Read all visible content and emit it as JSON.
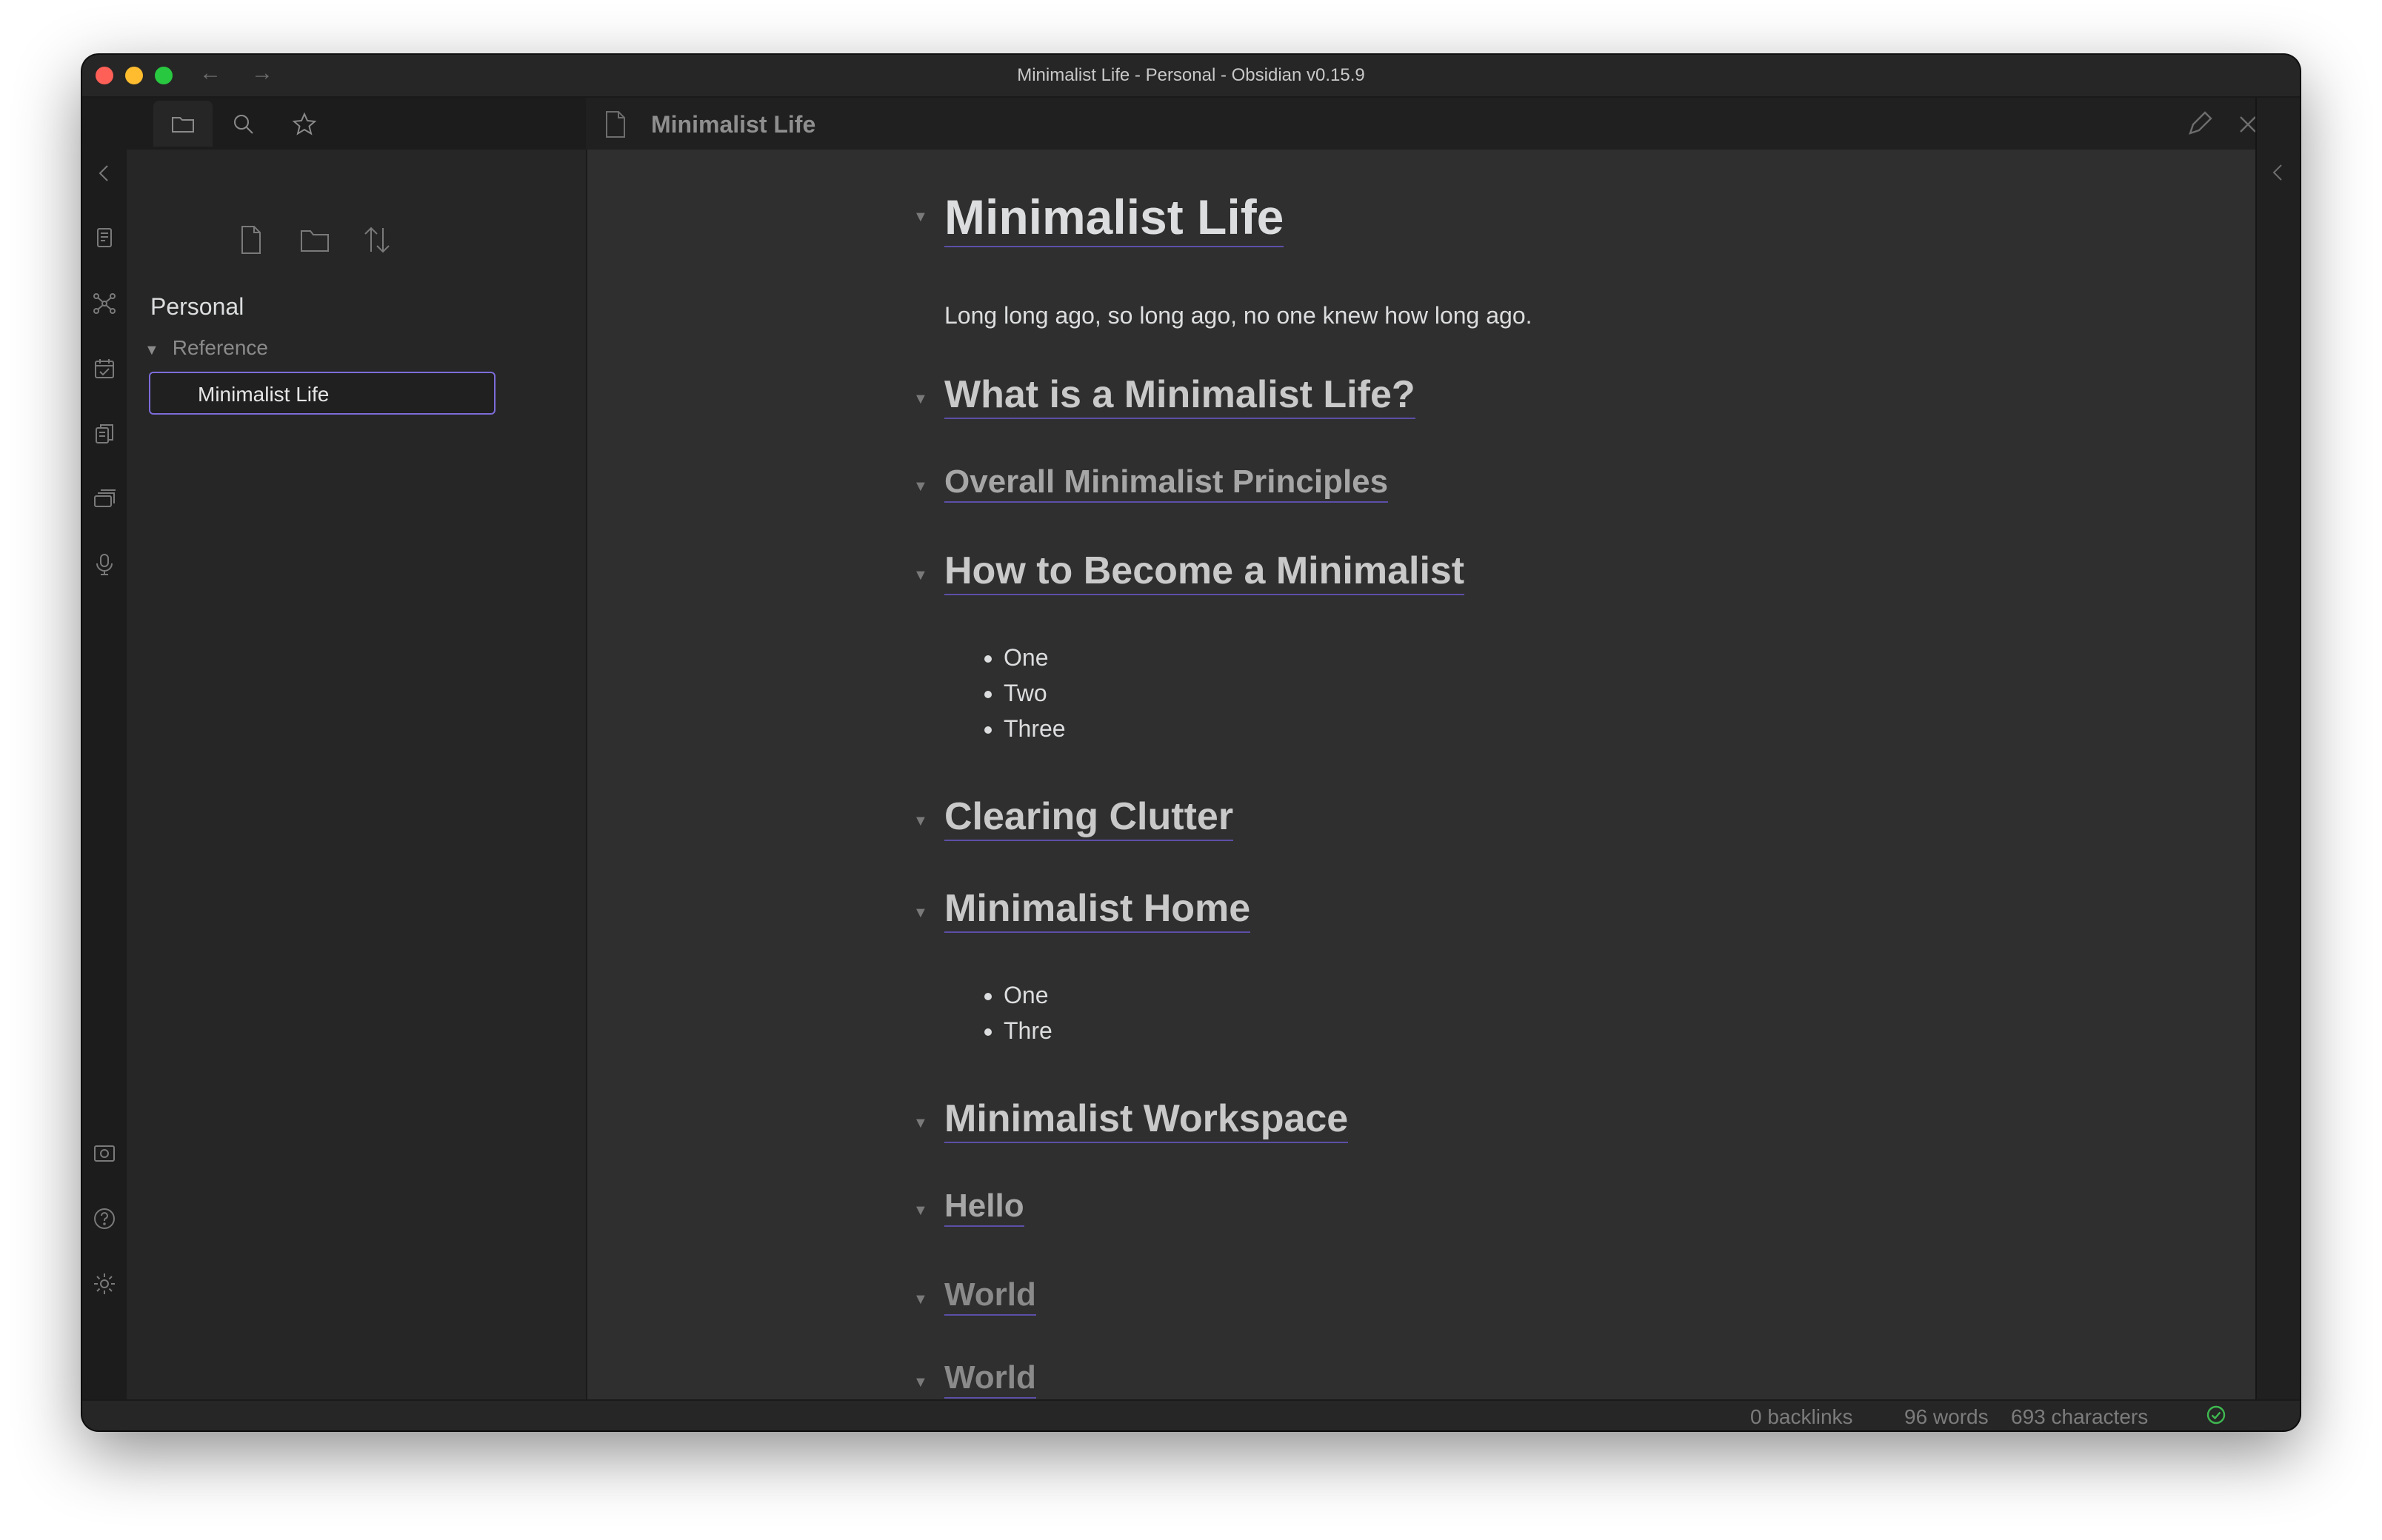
{
  "window": {
    "title": "Minimalist Life - Personal - Obsidian v0.15.9"
  },
  "titlebar": {
    "back_icon": "←",
    "forward_icon": "→"
  },
  "ribbon": {
    "top_icons": [
      "collapse-left-icon",
      "switcher-icon",
      "graph-icon",
      "daily-note-icon",
      "templates-icon",
      "slides-icon",
      "audio-recorder-icon"
    ],
    "bottom_icons": [
      "vault-icon",
      "help-icon",
      "settings-icon"
    ]
  },
  "sidebar": {
    "tabs": [
      "file-explorer-icon",
      "search-icon",
      "bookmark-star-icon"
    ],
    "actions": [
      "new-note-icon",
      "new-folder-icon",
      "sort-icon"
    ],
    "vault_name": "Personal",
    "folder": "Reference",
    "file": "Minimalist Life"
  },
  "editor": {
    "view_title": "Minimalist Life",
    "actions": [
      "edit-pencil-icon",
      "close-icon",
      "more-options-icon"
    ],
    "h1": "Minimalist Life",
    "paragraph": "Long long ago, so long ago, no one knew how long ago.",
    "h2_what": "What is a Minimalist Life?",
    "h3_overall": "Overall Minimalist Principles",
    "h2_how": "How to Become a Minimalist",
    "list1": [
      "One",
      "Two",
      "Three"
    ],
    "h2_clutter": "Clearing Clutter",
    "h2_home": "Minimalist Home",
    "list2": [
      "One",
      "Thre"
    ],
    "h2_workspace": "Minimalist Workspace",
    "h3_hello": "Hello",
    "h4_world": "World",
    "h5_world": "World"
  },
  "status": {
    "backlinks": "0 backlinks",
    "words": "96 words",
    "characters": "693 characters",
    "sync_color": "#3fb950"
  }
}
